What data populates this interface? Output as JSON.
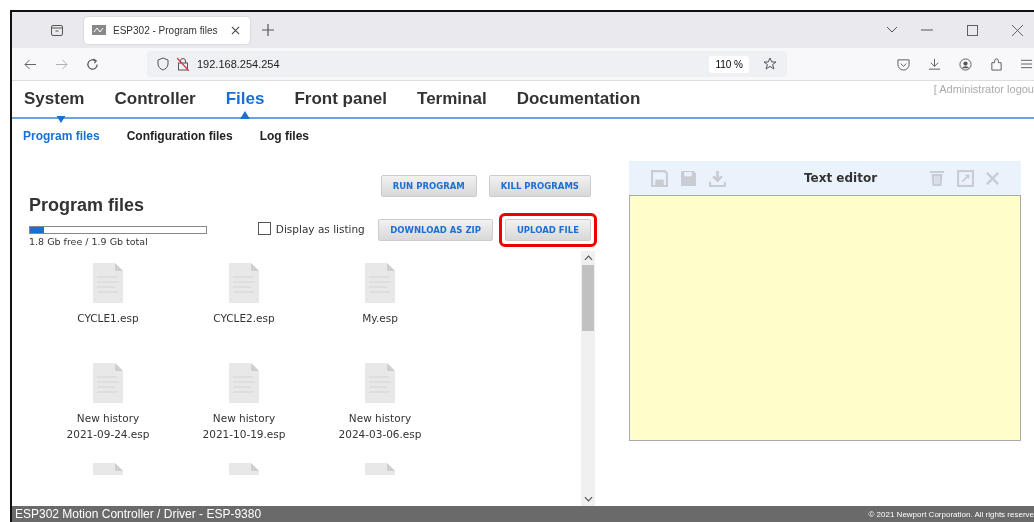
{
  "browser": {
    "tab_title": "ESP302 - Program files",
    "url": "192.168.254.254",
    "zoom": "110 %"
  },
  "nav": {
    "items": [
      {
        "label": "System",
        "selected": false
      },
      {
        "label": "Controller",
        "selected": false
      },
      {
        "label": "Files",
        "selected": true
      },
      {
        "label": "Front panel",
        "selected": false
      },
      {
        "label": "Terminal",
        "selected": false
      },
      {
        "label": "Documentation",
        "selected": false
      }
    ],
    "user": "[ Administrator logou"
  },
  "subnav": [
    {
      "label": "Program files",
      "selected": true
    },
    {
      "label": "Configuration files",
      "selected": false
    },
    {
      "label": "Log files",
      "selected": false
    }
  ],
  "files_panel": {
    "title": "Program files",
    "storage": {
      "level": 0.08,
      "reading": "1.8 Gb free / 1.9 Gb total"
    },
    "display_as_listing": {
      "label": "Display as listing",
      "checked": false
    },
    "buttons": [
      {
        "label": "RUN PROGRAM",
        "highlighted": false
      },
      {
        "label": "KILL PROGRAMS",
        "highlighted": false
      },
      {
        "label": "DOWNLOAD AS ZIP",
        "highlighted": false
      },
      {
        "label": "UPLOAD FILE",
        "highlighted": true
      }
    ],
    "files": [
      {
        "name": "CYCLE1.esp",
        "cut_off": false
      },
      {
        "name": "CYCLE2.esp",
        "cut_off": false
      },
      {
        "name": "My.esp",
        "cut_off": false
      },
      {
        "name": "New history 2021-09-24.esp",
        "cut_off": false
      },
      {
        "name": "New history 2021-10-19.esp",
        "cut_off": false
      },
      {
        "name": "New history 2024-03-06.esp",
        "cut_off": false
      },
      {
        "cut_off": true
      },
      {
        "cut_off": true
      },
      {
        "cut_off": true
      }
    ]
  },
  "text_editor": {
    "title": "Text editor"
  },
  "footer": {
    "left": "ESP302 Motion Controller / Driver - ESP-9380",
    "right": "© 2021 Newport Corporation. All rights reserve"
  }
}
